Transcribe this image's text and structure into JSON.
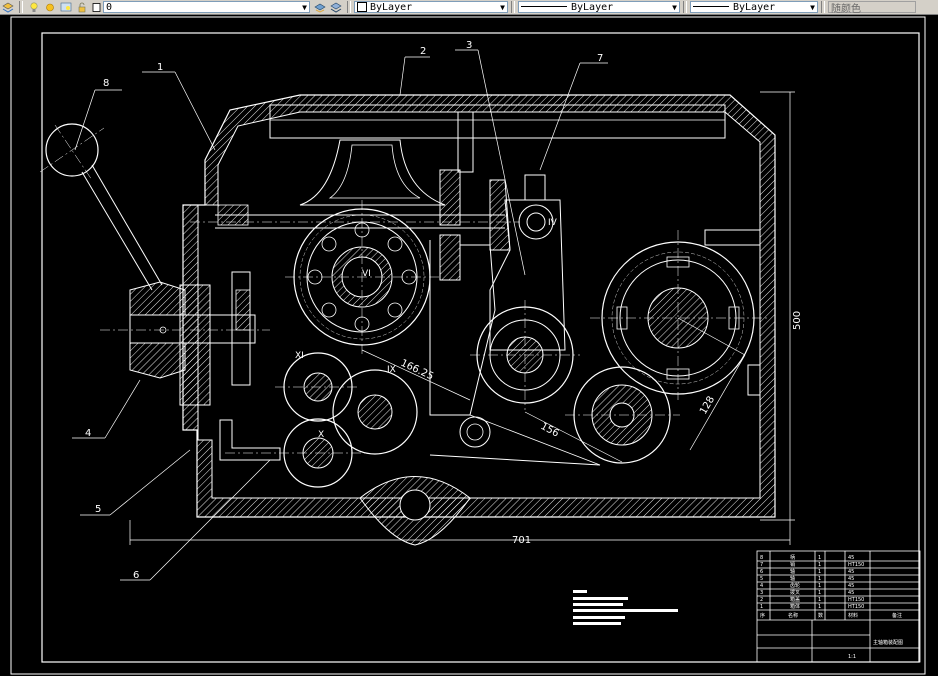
{
  "toolbar": {
    "layer_name": "0",
    "color_value": "ByLayer",
    "linetype_value": "ByLayer",
    "lineweight_value": "ByLayer",
    "plotstyle_value": "随颜色"
  },
  "drawing": {
    "part_labels": [
      "1",
      "2",
      "3",
      "4",
      "5",
      "6",
      "7",
      "8"
    ],
    "shaft_labels": [
      "VI",
      "IX",
      "XI",
      "X",
      "IV"
    ],
    "dimensions": {
      "width": "701",
      "height": "500",
      "d1": "166.25",
      "d2": "156",
      "d3": "128"
    }
  },
  "title_block": {
    "rows": [
      {
        "no": "8",
        "name": "柄",
        "qty": "1",
        "material": "45"
      },
      {
        "no": "7",
        "name": "销",
        "qty": "1",
        "material": "HT150"
      },
      {
        "no": "6",
        "name": "轴",
        "qty": "1",
        "material": "45"
      },
      {
        "no": "5",
        "name": "轴",
        "qty": "1",
        "material": "45"
      },
      {
        "no": "4",
        "name": "齿轮",
        "qty": "1",
        "material": "45"
      },
      {
        "no": "3",
        "name": "拨叉",
        "qty": "1",
        "material": "45"
      },
      {
        "no": "2",
        "name": "箱盖",
        "qty": "1",
        "material": "HT150"
      },
      {
        "no": "1",
        "name": "箱体",
        "qty": "1",
        "material": "HT150"
      }
    ],
    "header": {
      "no": "序",
      "name": "名称",
      "qty": "数",
      "material": "材料",
      "note": "备注"
    },
    "drawing_title": "主轴箱装配图",
    "scale": "1:1"
  }
}
